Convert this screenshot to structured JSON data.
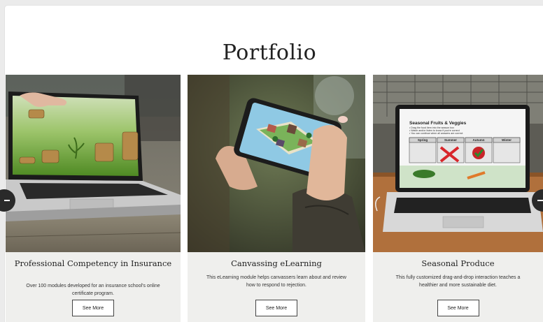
{
  "page": {
    "title": "Portfolio"
  },
  "cards": [
    {
      "title": "Professional Competency in Insurance",
      "description": "Over 100 modules developed for an insurance school's online certificate program.",
      "button": "See More"
    },
    {
      "title": "Canvassing eLearning",
      "description": "This eLearning module helps canvassers learn about and review how to respond to rejection.",
      "button": "See More"
    },
    {
      "title": "Seasonal Produce",
      "description": "This fully customized drag-and-drop interaction teaches a healthier and more sustainable diet.",
      "button": "See More"
    }
  ],
  "screen": {
    "heading": "Seasonal Fruits & Veggies",
    "instructions": [
      "• Drag the food item into the season box",
      "• Watch and/or listen to know if you're correct",
      "• You can continue when all answers are correct"
    ],
    "seasons": [
      "Spring",
      "Summer",
      "Autumn",
      "Winter"
    ]
  },
  "carousel": {
    "prev_icon": "arrow-left-icon",
    "next_icon": "arrow-right-icon"
  },
  "colors": {
    "card_bg": "#efefed",
    "title": "#222222",
    "arrow": "#2a2a2a"
  }
}
